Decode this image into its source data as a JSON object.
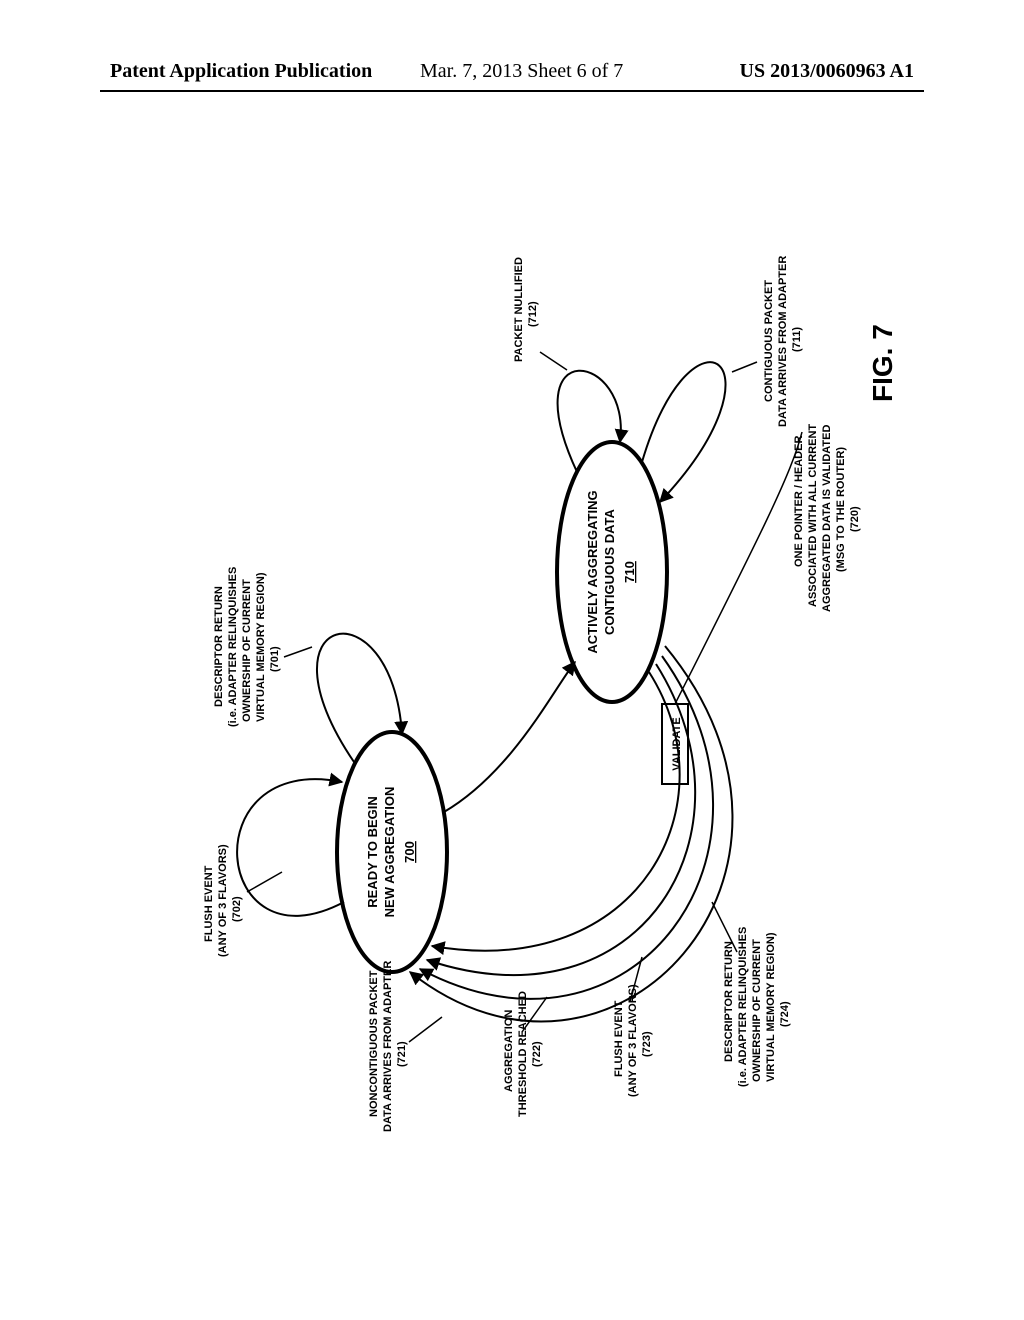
{
  "header": {
    "left": "Patent Application Publication",
    "mid": "Mar. 7, 2013  Sheet 6 of 7",
    "right": "US 2013/0060963 A1"
  },
  "figure_label": "FIG. 7",
  "states": {
    "s700": {
      "line1": "READY TO BEGIN",
      "line2": "NEW AGGREGATION",
      "num": "700"
    },
    "s710": {
      "line1": "ACTIVELY AGGREGATING",
      "line2": "CONTIGUOUS DATA",
      "num": "710"
    },
    "validate": "VALIDATE"
  },
  "transitions": {
    "t701": {
      "l1": "DESCRIPTOR RETURN",
      "l2": "(i.e. ADAPTER RELINQUISHES",
      "l3": "OWNERSHIP OF CURRENT",
      "l4": "VIRTUAL MEMORY REGION)",
      "ref": "(701)"
    },
    "t702": {
      "l1": "FLUSH EVENT",
      "l2": "(ANY OF 3 FLAVORS)",
      "ref": "(702)"
    },
    "t711": {
      "l1": "CONTIGUOUS PACKET",
      "l2": "DATA ARRIVES FROM ADAPTER",
      "ref": "(711)"
    },
    "t712": {
      "l1": "PACKET NULLIFIED",
      "ref": "(712)"
    },
    "t720": {
      "l1": "ONE POINTER / HEADER",
      "l2": "ASSOCIATED WITH ALL CURRENT",
      "l3": "AGGREGATED DATA IS VALIDATED",
      "l4": "(MSG TO THE ROUTER)",
      "ref": "(720)"
    },
    "t721": {
      "l1": "NONCONTIGUOUS PACKET",
      "l2": "DATA ARRIVES FROM ADAPTER",
      "ref": "(721)"
    },
    "t722": {
      "l1": "AGGREGATION",
      "l2": "THRESHOLD REACHED",
      "ref": "(722)"
    },
    "t723": {
      "l1": "FLUSH EVENT",
      "l2": "(ANY OF 3 FLAVORS)",
      "ref": "(723)"
    },
    "t724": {
      "l1": "DESCRIPTOR RETURN",
      "l2": "(i.e. ADAPTER RELINQUISHES",
      "l3": "OWNERSHIP OF CURRENT",
      "l4": "VIRTUAL MEMORY REGION)",
      "ref": "(724)"
    }
  }
}
